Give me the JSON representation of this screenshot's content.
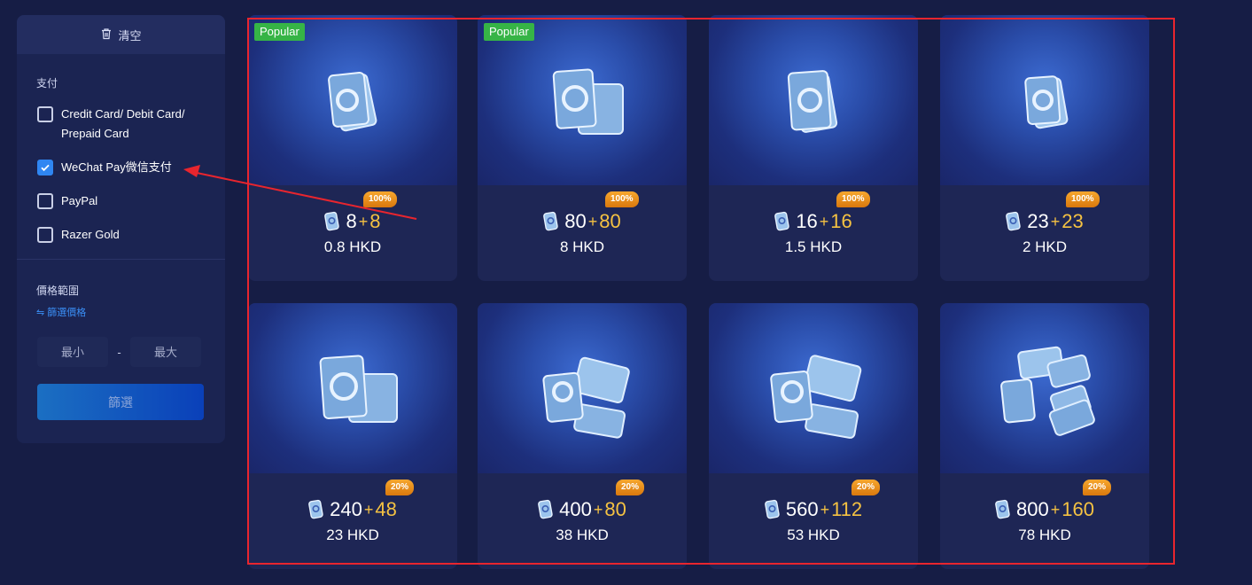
{
  "sidebar": {
    "clear_label": "清空",
    "payment_title": "支付",
    "payment_methods": [
      {
        "label": "Credit Card/ Debit Card/ Prepaid Card",
        "checked": false
      },
      {
        "label": "WeChat Pay微信支付",
        "checked": true
      },
      {
        "label": "PayPal",
        "checked": false
      },
      {
        "label": "Razer Gold",
        "checked": false
      }
    ],
    "price_title": "價格範圍",
    "price_link": "⇋ 篩選價格",
    "min_placeholder": "最小",
    "max_placeholder": "最大",
    "range_separator": "-",
    "filter_button": "篩選"
  },
  "products": [
    {
      "popular": "Popular",
      "bonus_tag": "100%",
      "amount": "8",
      "plus": "+",
      "bonus": "8",
      "price": "0.8 HKD"
    },
    {
      "popular": "Popular",
      "bonus_tag": "100%",
      "amount": "80",
      "plus": "+",
      "bonus": "80",
      "price": "8 HKD"
    },
    {
      "popular": "",
      "bonus_tag": "100%",
      "amount": "16",
      "plus": "+",
      "bonus": "16",
      "price": "1.5 HKD"
    },
    {
      "popular": "",
      "bonus_tag": "100%",
      "amount": "23",
      "plus": "+",
      "bonus": "23",
      "price": "2 HKD"
    },
    {
      "popular": "",
      "bonus_tag": "20%",
      "amount": "240",
      "plus": "+",
      "bonus": "48",
      "price": "23 HKD"
    },
    {
      "popular": "",
      "bonus_tag": "20%",
      "amount": "400",
      "plus": "+",
      "bonus": "80",
      "price": "38 HKD"
    },
    {
      "popular": "",
      "bonus_tag": "20%",
      "amount": "560",
      "plus": "+",
      "bonus": "112",
      "price": "53 HKD"
    },
    {
      "popular": "",
      "bonus_tag": "20%",
      "amount": "800",
      "plus": "+",
      "bonus": "160",
      "price": "78 HKD"
    }
  ],
  "colors": {
    "background": "#161d45",
    "card": "#1e2655",
    "accent_blue": "#2f86f2",
    "bonus_gold": "#f5c242",
    "popular_green": "#36b446",
    "highlight_red": "#e8252e"
  },
  "icons": [
    "trash-icon",
    "checkmark-icon",
    "card-currency-icon"
  ]
}
